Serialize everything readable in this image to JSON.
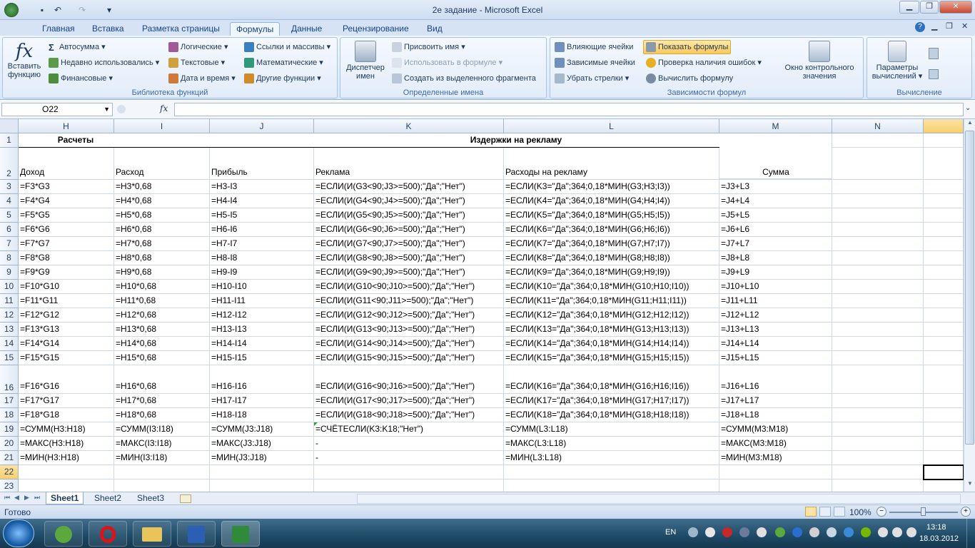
{
  "window": {
    "title": "2е задание - Microsoft Excel",
    "min": "▁",
    "max": "❐",
    "close": "✕"
  },
  "ribbon_tabs": [
    "Главная",
    "Вставка",
    "Разметка страницы",
    "Формулы",
    "Данные",
    "Рецензирование",
    "Вид"
  ],
  "active_tab": "Формулы",
  "groups": {
    "library": {
      "label": "Библиотека функций",
      "insert_fn": "Вставить функцию",
      "autosum": "Автосумма",
      "recent": "Недавно использовались",
      "financial": "Финансовые",
      "logical": "Логические",
      "text": "Текстовые",
      "datetime": "Дата и время",
      "links": "Ссылки и массивы",
      "math": "Математические",
      "other": "Другие функции"
    },
    "names": {
      "label": "Определенные имена",
      "manager": "Диспетчер имен",
      "assign": "Присвоить имя",
      "use_in_formula": "Использовать в формуле",
      "create_from_sel": "Создать из выделенного фрагмента"
    },
    "audit": {
      "label": "Зависимости формул",
      "precedents": "Влияющие ячейки",
      "dependents": "Зависимые ячейки",
      "remove_arrows": "Убрать стрелки",
      "show_formulas": "Показать формулы",
      "error_check": "Проверка наличия ошибок",
      "evaluate": "Вычислить формулу",
      "watch": "Окно контрольного значения"
    },
    "calc": {
      "label": "Вычисление",
      "options": "Параметры вычислений"
    }
  },
  "formula_bar": {
    "name_box": "O22",
    "fx": "fx",
    "content": ""
  },
  "columns": [
    "H",
    "I",
    "J",
    "K",
    "L",
    "M",
    "N"
  ],
  "rows": [
    {
      "n": "1",
      "H": "Расчеты",
      "I": "",
      "J": "",
      "K": "",
      "L": "",
      "M": ""
    },
    {
      "n": "2",
      "H": "Доход",
      "I": "Расход",
      "J": "Прибыль",
      "K": "Реклама",
      "L": "Расходы на рекламу",
      "M": "Сумма"
    },
    {
      "n": "3",
      "H": "=F3*G3",
      "I": "=H3*0,68",
      "J": "=H3-I3",
      "K": "=ЕСЛИ(И(G3<90;J3>=500);\"Да\";\"Нет\")",
      "L": "=ЕСЛИ(K3=\"Да\";364;0,18*МИН(G3;H3;I3))",
      "M": "=J3+L3"
    },
    {
      "n": "4",
      "H": "=F4*G4",
      "I": "=H4*0,68",
      "J": "=H4-I4",
      "K": "=ЕСЛИ(И(G4<90;J4>=500);\"Да\";\"Нет\")",
      "L": "=ЕСЛИ(K4=\"Да\";364;0,18*МИН(G4;H4;I4))",
      "M": "=J4+L4"
    },
    {
      "n": "5",
      "H": "=F5*G5",
      "I": "=H5*0,68",
      "J": "=H5-I5",
      "K": "=ЕСЛИ(И(G5<90;J5>=500);\"Да\";\"Нет\")",
      "L": "=ЕСЛИ(K5=\"Да\";364;0,18*МИН(G5;H5;I5))",
      "M": "=J5+L5"
    },
    {
      "n": "6",
      "H": "=F6*G6",
      "I": "=H6*0,68",
      "J": "=H6-I6",
      "K": "=ЕСЛИ(И(G6<90;J6>=500);\"Да\";\"Нет\")",
      "L": "=ЕСЛИ(K6=\"Да\";364;0,18*МИН(G6;H6;I6))",
      "M": "=J6+L6"
    },
    {
      "n": "7",
      "H": "=F7*G7",
      "I": "=H7*0,68",
      "J": "=H7-I7",
      "K": "=ЕСЛИ(И(G7<90;J7>=500);\"Да\";\"Нет\")",
      "L": "=ЕСЛИ(K7=\"Да\";364;0,18*МИН(G7;H7;I7))",
      "M": "=J7+L7"
    },
    {
      "n": "8",
      "H": "=F8*G8",
      "I": "=H8*0,68",
      "J": "=H8-I8",
      "K": "=ЕСЛИ(И(G8<90;J8>=500);\"Да\";\"Нет\")",
      "L": "=ЕСЛИ(K8=\"Да\";364;0,18*МИН(G8;H8;I8))",
      "M": "=J8+L8"
    },
    {
      "n": "9",
      "H": "=F9*G9",
      "I": "=H9*0,68",
      "J": "=H9-I9",
      "K": "=ЕСЛИ(И(G9<90;J9>=500);\"Да\";\"Нет\")",
      "L": "=ЕСЛИ(K9=\"Да\";364;0,18*МИН(G9;H9;I9))",
      "M": "=J9+L9"
    },
    {
      "n": "10",
      "H": "=F10*G10",
      "I": "=H10*0,68",
      "J": "=H10-I10",
      "K": "=ЕСЛИ(И(G10<90;J10>=500);\"Да\";\"Нет\")",
      "L": "=ЕСЛИ(K10=\"Да\";364;0,18*МИН(G10;H10;I10))",
      "M": "=J10+L10"
    },
    {
      "n": "11",
      "H": "=F11*G11",
      "I": "=H11*0,68",
      "J": "=H11-I11",
      "K": "=ЕСЛИ(И(G11<90;J11>=500);\"Да\";\"Нет\")",
      "L": "=ЕСЛИ(K11=\"Да\";364;0,18*МИН(G11;H11;I11))",
      "M": "=J11+L11"
    },
    {
      "n": "12",
      "H": "=F12*G12",
      "I": "=H12*0,68",
      "J": "=H12-I12",
      "K": "=ЕСЛИ(И(G12<90;J12>=500);\"Да\";\"Нет\")",
      "L": "=ЕСЛИ(K12=\"Да\";364;0,18*МИН(G12;H12;I12))",
      "M": "=J12+L12"
    },
    {
      "n": "13",
      "H": "=F13*G13",
      "I": "=H13*0,68",
      "J": "=H13-I13",
      "K": "=ЕСЛИ(И(G13<90;J13>=500);\"Да\";\"Нет\")",
      "L": "=ЕСЛИ(K13=\"Да\";364;0,18*МИН(G13;H13;I13))",
      "M": "=J13+L13"
    },
    {
      "n": "14",
      "H": "=F14*G14",
      "I": "=H14*0,68",
      "J": "=H14-I14",
      "K": "=ЕСЛИ(И(G14<90;J14>=500);\"Да\";\"Нет\")",
      "L": "=ЕСЛИ(K14=\"Да\";364;0,18*МИН(G14;H14;I14))",
      "M": "=J14+L14"
    },
    {
      "n": "15",
      "H": "=F15*G15",
      "I": "=H15*0,68",
      "J": "=H15-I15",
      "K": "=ЕСЛИ(И(G15<90;J15>=500);\"Да\";\"Нет\")",
      "L": "=ЕСЛИ(K15=\"Да\";364;0,18*МИН(G15;H15;I15))",
      "M": "=J15+L15"
    },
    {
      "n": "16",
      "H": "=F16*G16",
      "I": "=H16*0,68",
      "J": "=H16-I16",
      "K": "=ЕСЛИ(И(G16<90;J16>=500);\"Да\";\"Нет\")",
      "L": "=ЕСЛИ(K16=\"Да\";364;0,18*МИН(G16;H16;I16))",
      "M": "=J16+L16"
    },
    {
      "n": "17",
      "H": "=F17*G17",
      "I": "=H17*0,68",
      "J": "=H17-I17",
      "K": "=ЕСЛИ(И(G17<90;J17>=500);\"Да\";\"Нет\")",
      "L": "=ЕСЛИ(K17=\"Да\";364;0,18*МИН(G17;H17;I17))",
      "M": "=J17+L17"
    },
    {
      "n": "18",
      "H": "=F18*G18",
      "I": "=H18*0,68",
      "J": "=H18-I18",
      "K": "=ЕСЛИ(И(G18<90;J18>=500);\"Да\";\"Нет\")",
      "L": "=ЕСЛИ(K18=\"Да\";364;0,18*МИН(G18;H18;I18))",
      "M": "=J18+L18"
    },
    {
      "n": "19",
      "H": "=СУММ(H3:H18)",
      "I": "=СУММ(I3:I18)",
      "J": "=СУММ(J3:J18)",
      "K": "=СЧЁТЕСЛИ(K3:K18;\"Нет\")",
      "L": "=СУММ(L3:L18)",
      "M": "=СУММ(M3:M18)"
    },
    {
      "n": "20",
      "H": "=МАКС(H3:H18)",
      "I": "=МАКС(I3:I18)",
      "J": "=МАКС(J3:J18)",
      "K": "-",
      "L": "=МАКС(L3:L18)",
      "M": "=МАКС(M3:M18)"
    },
    {
      "n": "21",
      "H": "=МИН(H3:H18)",
      "I": "=МИН(I3:I18)",
      "J": "=МИН(J3:J18)",
      "K": "-",
      "L": "=МИН(L3:L18)",
      "M": "=МИН(M3:M18)"
    },
    {
      "n": "22",
      "H": "",
      "I": "",
      "J": "",
      "K": "",
      "L": "",
      "M": ""
    },
    {
      "n": "23",
      "H": "",
      "I": "",
      "J": "",
      "K": "",
      "L": "",
      "M": ""
    }
  ],
  "merged_header_KL": "Издержки на рекламу",
  "sheets": [
    "Sheet1",
    "Sheet2",
    "Sheet3"
  ],
  "active_sheet": "Sheet1",
  "status": {
    "ready": "Готово",
    "zoom": "100%"
  },
  "taskbar": {
    "lang": "EN",
    "time": "13:18",
    "date": "18.03.2012"
  }
}
